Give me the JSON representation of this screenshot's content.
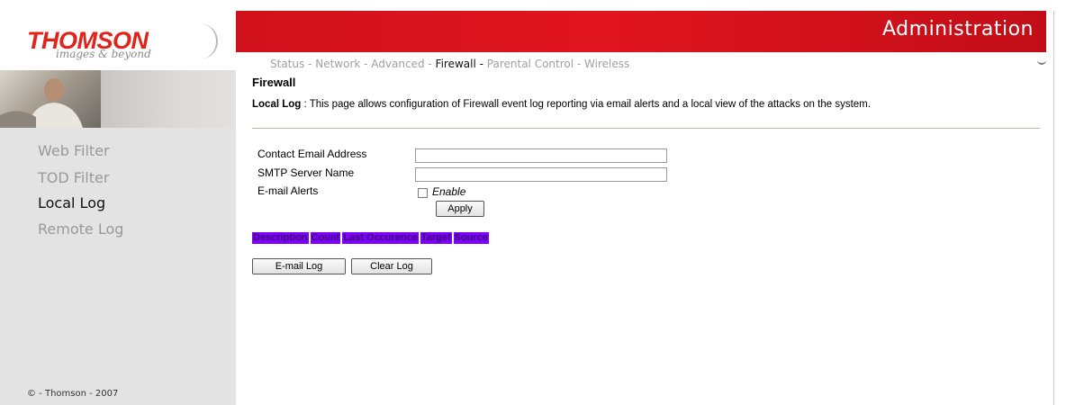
{
  "brand": {
    "name": "THOMSON",
    "tagline": "images & beyond"
  },
  "header": {
    "title": "Administration"
  },
  "nav": {
    "items": [
      {
        "label": "Status",
        "active": false
      },
      {
        "label": "Network",
        "active": false
      },
      {
        "label": "Advanced",
        "active": false
      },
      {
        "label": "Firewall",
        "active": true
      },
      {
        "label": "Parental Control",
        "active": false
      },
      {
        "label": "Wireless",
        "active": false
      }
    ],
    "separator": " - "
  },
  "sidebar": {
    "items": [
      {
        "label": "Web Filter",
        "active": false
      },
      {
        "label": "TOD Filter",
        "active": false
      },
      {
        "label": "Local Log",
        "active": true
      },
      {
        "label": "Remote Log",
        "active": false
      }
    ],
    "copyright": "© - Thomson - 2007"
  },
  "main": {
    "title": "Firewall",
    "description_label": "Local Log",
    "description_sep": " :  ",
    "description_text": "This page allows configuration of Firewall event log reporting via email alerts and a local view of the attacks on the system.",
    "form": {
      "email_label": "Contact Email Address",
      "email_value": "",
      "smtp_label": "SMTP Server Name",
      "smtp_value": "",
      "alerts_label": "E-mail Alerts",
      "enable_label": "Enable",
      "enable_checked": false,
      "apply_button": "Apply"
    },
    "log_table": {
      "columns": [
        "Description",
        "Count",
        "Last Occurence",
        "Target",
        "Source"
      ]
    },
    "buttons": {
      "email_log": "E-mail Log",
      "clear_log": "Clear Log"
    }
  },
  "colors": {
    "header_red": "#e1151f",
    "brand_red": "#e2231a",
    "log_header_bg": "#8000ff",
    "log_header_text": "#3a006b",
    "sidebar_bg": "#e3e3e3"
  }
}
